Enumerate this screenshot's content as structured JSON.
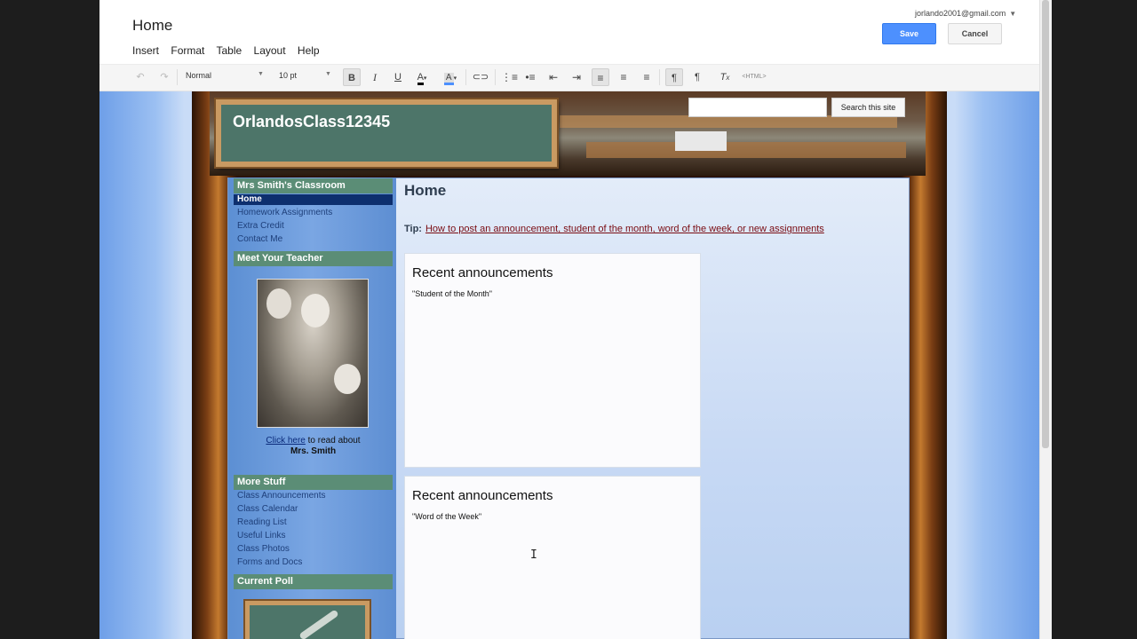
{
  "editor": {
    "title": "Home",
    "menu": [
      "Insert",
      "Format",
      "Table",
      "Layout",
      "Help"
    ],
    "account": "jorlando2001@gmail.com",
    "save_label": "Save",
    "cancel_label": "Cancel",
    "colors": {
      "save": "#4d90fe"
    }
  },
  "toolbar": {
    "style_select": "Normal",
    "size_select": "10 pt",
    "html_label": "<HTML>",
    "icons": [
      "undo-icon",
      "redo-icon",
      "bold-icon",
      "italic-icon",
      "underline-icon",
      "text-color-icon",
      "highlight-icon",
      "link-icon",
      "numbered-list-icon",
      "bulleted-list-icon",
      "outdent-icon",
      "indent-icon",
      "align-left-icon",
      "align-center-icon",
      "align-right-icon",
      "ltr-icon",
      "rtl-icon",
      "clear-format-icon"
    ]
  },
  "site": {
    "title": "OrlandosClass12345",
    "search_button": "Search this site",
    "sidebar": {
      "classroom_heading": "Mrs Smith's Classroom",
      "nav": [
        "Home",
        "Homework Assignments",
        "Extra Credit",
        "Contact Me"
      ],
      "teacher_heading": "Meet Your Teacher",
      "click_here": "Click here",
      "read_about": " to read about",
      "teacher_name": "Mrs. Smith",
      "more_heading": "More Stuff",
      "more_links": [
        "Class Announcements",
        "Class Calendar",
        "Reading List",
        "Useful Links",
        "Class Photos",
        "Forms and Docs"
      ],
      "poll_heading": "Current Poll"
    },
    "main": {
      "heading": "Home",
      "tip_label": "Tip:",
      "tip_link": "How to post an announcement, student of the month, word of the week, or new assignments",
      "announcements": [
        {
          "title": "Recent announcements",
          "subtitle": "\"Student of the Month\""
        },
        {
          "title": "Recent announcements",
          "subtitle": "\"Word of the Week\""
        }
      ]
    }
  }
}
